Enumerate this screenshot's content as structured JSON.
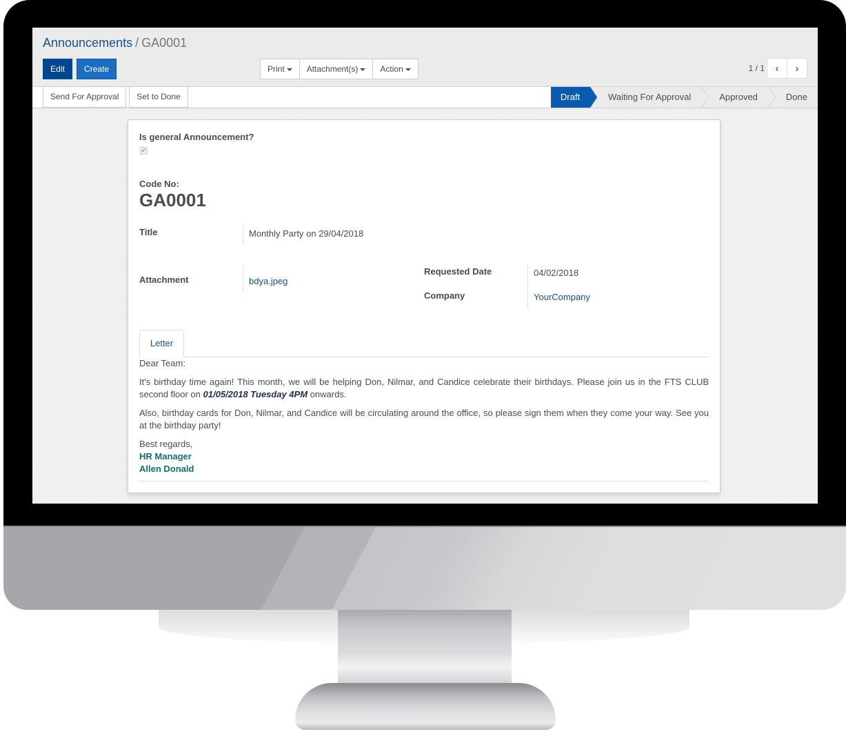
{
  "breadcrumb": {
    "parent": "Announcements",
    "separator": "/",
    "current": "GA0001"
  },
  "toolbar": {
    "edit_label": "Edit",
    "create_label": "Create",
    "print_label": "Print",
    "attachments_label": "Attachment(s)",
    "action_label": "Action"
  },
  "pager": {
    "value": "1 / 1",
    "prev_icon": "‹",
    "next_icon": "›"
  },
  "statusbar": {
    "buttons": [
      "Send For Approval",
      "Set to Done"
    ],
    "steps": [
      {
        "label": "Draft",
        "active": true
      },
      {
        "label": "Waiting For Approval",
        "active": false
      },
      {
        "label": "Approved",
        "active": false
      },
      {
        "label": "Done",
        "active": false
      }
    ]
  },
  "form": {
    "general_label": "Is general Announcement?",
    "general_checked": true,
    "checkbox_glyph": "✔",
    "code_label": "Code No:",
    "code_value": "GA0001",
    "title_label": "Title",
    "title_value": "Monthly Party on 29/04/2018",
    "attachment_label": "Attachment",
    "attachment_value": "bdya.jpeg",
    "requested_date_label": "Requested Date",
    "requested_date_value": "04/02/2018",
    "company_label": "Company",
    "company_value": "YourCompany"
  },
  "tabs": [
    {
      "label": "Letter",
      "active": true
    }
  ],
  "letter": {
    "greeting": "Dear Team:",
    "p1_before": "It's birthday time again! This month, we will be helping Don, Nilmar, and Candice celebrate their birthdays. Please join us in the FTS CLUB second floor on ",
    "p1_emphasis": "01/05/2018 Tuesday 4PM",
    "p1_after": " onwards.",
    "p2": "Also, birthday cards for Don, Nilmar, and Candice will be circulating around the office, so please sign them when they come your way. See you at the birthday party!",
    "closing": "Best regards,",
    "sig_role": "HR Manager",
    "sig_name": "Allen Donald"
  },
  "colors": {
    "primary": "#00468f",
    "secondary_button": "#1b6ec2",
    "active_step": "#0a5ab0",
    "link": "#1a4f8b",
    "signature": "#1a6b6b"
  }
}
